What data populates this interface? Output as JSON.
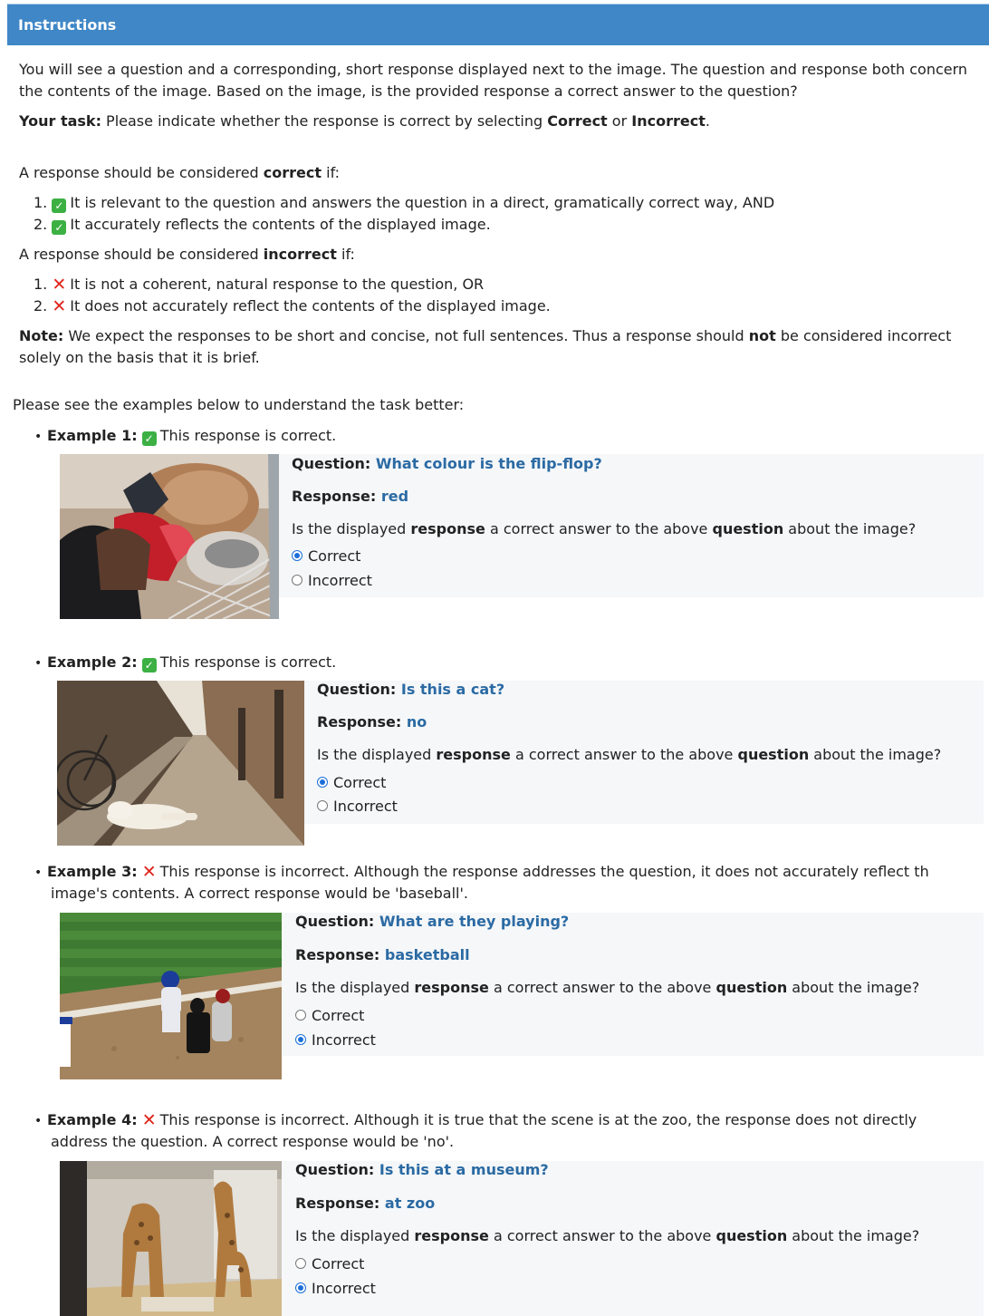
{
  "header": {
    "title": "Instructions"
  },
  "intro": {
    "p1": "You will see a question and a corresponding, short response displayed next to the image. The question and response both concern the contents of the image. Based on the image, is the provided response a correct answer to the question?",
    "task_label": "Your task:",
    "task_text": " Please indicate whether the response is correct by selecting ",
    "task_correct": "Correct",
    "task_or": " or ",
    "task_incorrect": "Incorrect",
    "task_end": ".",
    "correct_lead": "A response should be considered ",
    "correct_word": "correct",
    "correct_tail": " if:",
    "correct_items": [
      "It is relevant to the question and answers the question in a direct, gramatically correct way, AND",
      "It accurately reflects the contents of the displayed image."
    ],
    "incorrect_lead": "A response should be considered ",
    "incorrect_word": "incorrect",
    "incorrect_tail": " if:",
    "incorrect_items": [
      "It is not a coherent, natural response to the question, OR",
      "It does not accurately reflect the contents of the displayed image."
    ],
    "note_label": "Note:",
    "note_a": " We expect the responses to be short and concise, not full sentences. Thus a response should ",
    "note_not": "not",
    "note_b": " be considered incorrect",
    "note_c": "solely on the basis that it is brief.",
    "see_examples": "Please see the examples below to understand the task better:"
  },
  "common": {
    "question_label": "Question:",
    "response_label": "Response:",
    "prompt_a": "Is the displayed ",
    "prompt_response": "response",
    "prompt_b": " a correct answer to the above ",
    "prompt_question": "question",
    "prompt_c": " about the image?",
    "opt_correct": "Correct",
    "opt_incorrect": "Incorrect",
    "num1": "1.",
    "num2": "2."
  },
  "examples": [
    {
      "label": "Example 1:",
      "verdict": "This response is correct.",
      "question": "What colour is the flip-flop?",
      "response": "red",
      "selected": "Correct"
    },
    {
      "label": "Example 2:",
      "verdict": "This response is correct.",
      "question": "Is this a cat?",
      "response": "no",
      "selected": "Correct"
    },
    {
      "label": "Example 3:",
      "verdict": "This response is incorrect. Although the response addresses the question, it does not accurately reflect th",
      "verdict2": "image's contents. A correct response would be 'baseball'.",
      "question": "What are they playing?",
      "response": "basketball",
      "selected": "Incorrect"
    },
    {
      "label": "Example 4:",
      "verdict": "This response is incorrect. Although it is true that the scene is at the zoo, the response does not directly",
      "verdict2": "address the question. A correct response would be 'no'.",
      "question": "Is this at a museum?",
      "response": "at zoo",
      "selected": "Incorrect"
    }
  ],
  "colors": {
    "header": "#3f87c6",
    "value_blue": "#2b6aa3",
    "check_green": "#3cb043",
    "cross_red": "#e0241b",
    "radio_blue": "#1b6fd9"
  },
  "icons": {
    "correct": "check-mark-icon",
    "incorrect": "cross-mark-icon"
  }
}
